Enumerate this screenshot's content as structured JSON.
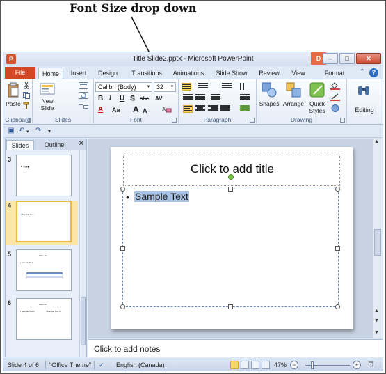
{
  "annotation": {
    "label": "Font Size drop down"
  },
  "window": {
    "title": "Title Slide2.pptx - Microsoft PowerPoint",
    "app_icon": "P",
    "contextual_badge": "D",
    "controls": {
      "minimize": "–",
      "maximize": "□",
      "close": "✕"
    }
  },
  "tabs": {
    "file": "File",
    "items": [
      "Home",
      "Insert",
      "Design",
      "Transitions",
      "Animations",
      "Slide Show",
      "Review",
      "View",
      "Format"
    ],
    "active": "Home"
  },
  "ribbon": {
    "clipboard": {
      "label": "Clipboard",
      "paste": "Paste"
    },
    "slides": {
      "label": "Slides",
      "new_slide_line1": "New",
      "new_slide_line2": "Slide"
    },
    "font": {
      "label": "Font",
      "font_name": "Calibri (Body)",
      "font_size": "32",
      "bold": "B",
      "italic": "I",
      "underline": "U",
      "shadow": "S",
      "strikethrough": "abc",
      "char_spacing": "AV",
      "font_color": "A",
      "change_case": "Aa",
      "grow": "A",
      "shrink": "A"
    },
    "paragraph": {
      "label": "Paragraph"
    },
    "drawing": {
      "label": "Drawing",
      "shapes": "Shapes",
      "arrange": "Arrange",
      "quick_styles_line1": "Quick",
      "quick_styles_line2": "Styles"
    },
    "editing": {
      "label": "Editing"
    }
  },
  "left_pane": {
    "tab_slides": "Slides",
    "tab_outline": "Outline",
    "close": "✕",
    "thumbnails": [
      {
        "number": "3",
        "text": "• ○●●"
      },
      {
        "number": "4",
        "text": "• Sample Text"
      },
      {
        "number": "5",
        "title": "Slide #1",
        "text": "• Sample Text"
      },
      {
        "number": "6",
        "title": "Slide #2",
        "text": "• Sample Text 1",
        "text2": "• Sample Text 2"
      }
    ]
  },
  "slide": {
    "title_placeholder": "Click to add title",
    "bullet": "•",
    "body_text": "Sample Text"
  },
  "notes": {
    "placeholder": "Click to add notes"
  },
  "status": {
    "slide_info": "Slide 4 of 6",
    "theme": "\"Office Theme\"",
    "language": "English (Canada)",
    "zoom": "47%"
  },
  "colors": {
    "file_tab": "#d24726",
    "selection_highlight": "#a9c3e6",
    "active_thumb": "#f2b53e",
    "arrow": "#111111"
  }
}
